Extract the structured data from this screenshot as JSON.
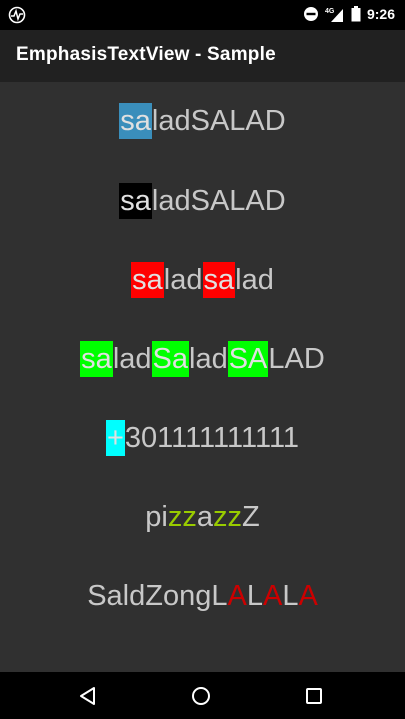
{
  "status_bar": {
    "time": "9:26",
    "network_label": "4G",
    "icons": [
      "activity-icon",
      "do-not-disturb-icon",
      "signal-icon",
      "battery-icon"
    ]
  },
  "app_bar": {
    "title": "EmphasisTextView - Sample"
  },
  "samples": [
    {
      "segments": [
        {
          "text": "sa",
          "bg": "#3a8ebb",
          "fg": "#e0e0e0"
        },
        {
          "text": "ladSALAD"
        }
      ]
    },
    {
      "segments": [
        {
          "text": "sa",
          "bg": "#000000",
          "fg": "#e0e0e0"
        },
        {
          "text": "ladSALAD"
        }
      ]
    },
    {
      "segments": [
        {
          "text": "sa",
          "bg": "#ff0000",
          "fg": "#e0e0e0"
        },
        {
          "text": "lad"
        },
        {
          "text": "sa",
          "bg": "#ff0000",
          "fg": "#e0e0e0"
        },
        {
          "text": "lad"
        }
      ]
    },
    {
      "segments": [
        {
          "text": "sa",
          "bg": "#00ff00",
          "fg": "#e0e0e0"
        },
        {
          "text": "lad"
        },
        {
          "text": "Sa",
          "bg": "#00ff00",
          "fg": "#e0e0e0"
        },
        {
          "text": "lad"
        },
        {
          "text": "SA",
          "bg": "#00ff00",
          "fg": "#e0e0e0"
        },
        {
          "text": "LAD"
        }
      ]
    },
    {
      "segments": [
        {
          "text": "+",
          "bg": "#00ffff",
          "fg": "#e0e0e0"
        },
        {
          "text": "301111111111"
        }
      ]
    },
    {
      "segments": [
        {
          "text": "pi"
        },
        {
          "text": "zz",
          "fg": "#99cc00"
        },
        {
          "text": "a"
        },
        {
          "text": "zz",
          "fg": "#99cc00"
        },
        {
          "text": "Z"
        }
      ]
    },
    {
      "segments": [
        {
          "text": "SaldZongL"
        },
        {
          "text": "A",
          "fg": "#cc0000"
        },
        {
          "text": "L"
        },
        {
          "text": "A",
          "fg": "#cc0000"
        },
        {
          "text": "L"
        },
        {
          "text": "A",
          "fg": "#cc0000"
        }
      ]
    }
  ],
  "nav_bar": {
    "buttons": [
      "back-icon",
      "home-icon",
      "recents-icon"
    ]
  },
  "colors": {
    "text": "#c8c8c8",
    "background": "#303030",
    "app_bar": "#212121"
  }
}
